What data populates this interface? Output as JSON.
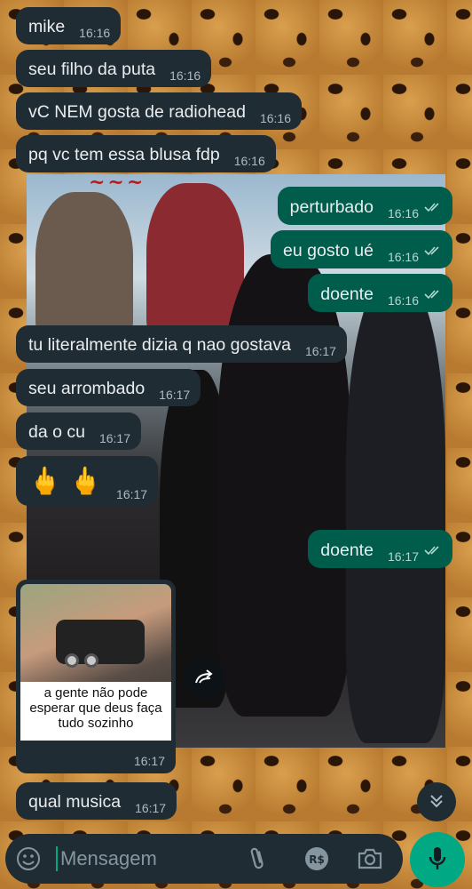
{
  "messages_in_top": [
    {
      "text": "mike",
      "time": "16:16"
    },
    {
      "text": "seu filho da puta",
      "time": "16:16"
    },
    {
      "text": "vC NEM gosta de radiohead",
      "time": "16:16"
    },
    {
      "text": "pq vc tem essa blusa fdp",
      "time": "16:16"
    }
  ],
  "messages_out_1": [
    {
      "text": "perturbado",
      "time": "16:16"
    },
    {
      "text": "eu gosto ué",
      "time": "16:16"
    },
    {
      "text": "doente",
      "time": "16:16"
    }
  ],
  "messages_in_mid": [
    {
      "text": "tu literalmente dizia q nao gostava",
      "time": "16:17"
    },
    {
      "text": "seu arrombado",
      "time": "16:17"
    },
    {
      "text": "da o cu",
      "time": "16:17"
    },
    {
      "text": "🖕 🖕",
      "time": "16:17"
    }
  ],
  "message_out_2": {
    "text": "doente",
    "time": "16:17"
  },
  "image_message": {
    "caption": "a gente não pode esperar que deus faça tudo sozinho",
    "time": "16:17"
  },
  "message_last": {
    "text": "qual musica",
    "time": "16:17"
  },
  "composer": {
    "placeholder": "Mensagem",
    "value": ""
  },
  "wallpaper_banner": "~~~",
  "icons": {
    "emoji": "emoji-icon",
    "attach": "paperclip-icon",
    "payment": "rupee-payment-icon",
    "camera": "camera-icon",
    "mic": "mic-icon",
    "forward": "forward-icon",
    "scroll": "double-chevron-down-icon",
    "read": "double-check-icon"
  },
  "colors": {
    "incoming": "#202c33",
    "outgoing": "#005c4b",
    "accent": "#00a884",
    "read_ticks": "#b4d7cf"
  }
}
